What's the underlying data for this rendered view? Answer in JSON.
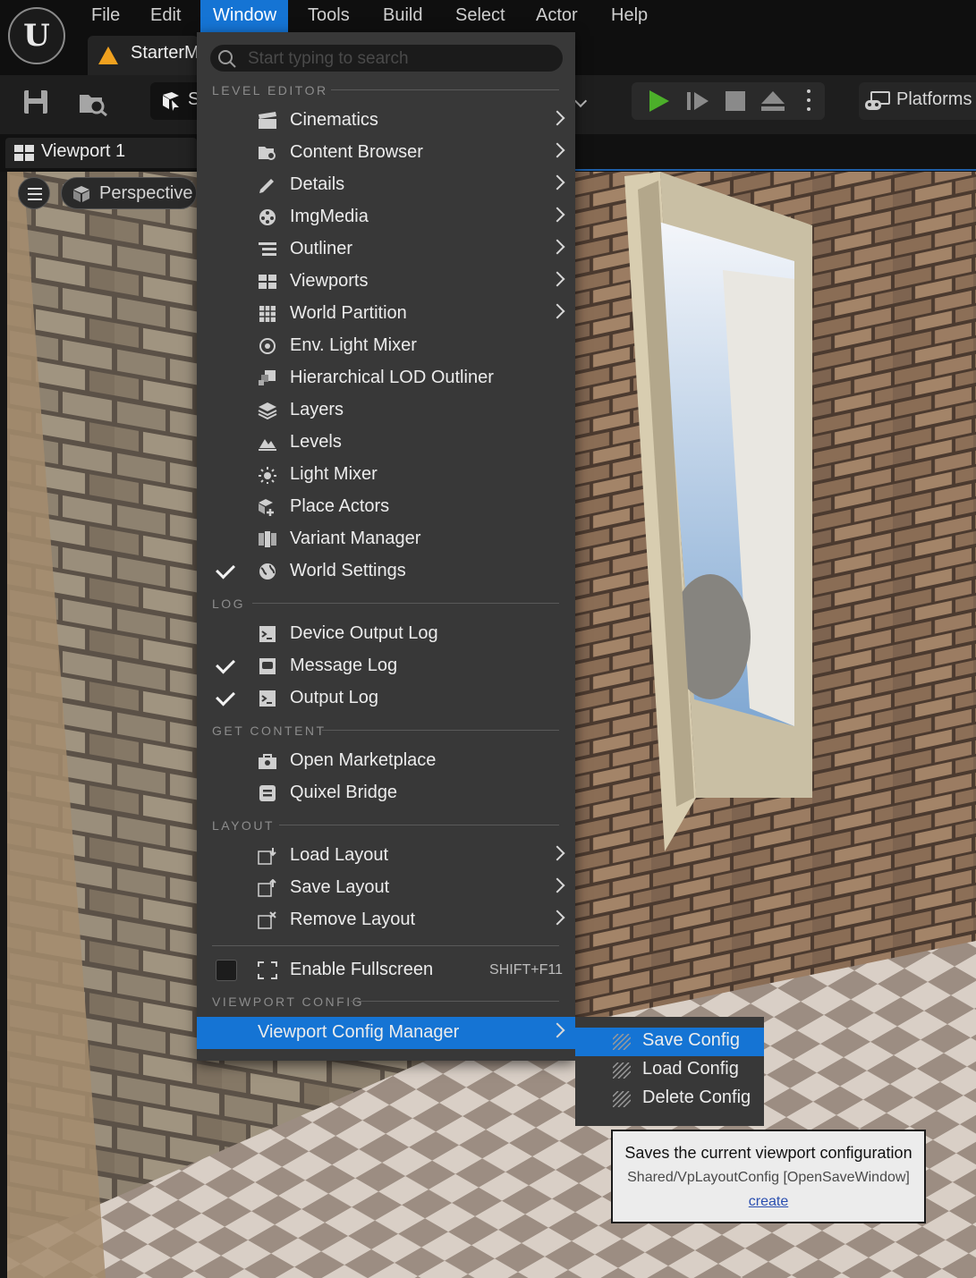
{
  "menubar": {
    "items": [
      "File",
      "Edit",
      "Window",
      "Tools",
      "Build",
      "Select",
      "Actor",
      "Help"
    ],
    "active": "Window"
  },
  "project_tab": {
    "label": "StarterM"
  },
  "toolbar": {
    "mode_label": "S",
    "platforms_label": "Platforms"
  },
  "viewport_tab": {
    "label": "Viewport 1"
  },
  "viewport": {
    "perspective_label": "Perspective"
  },
  "window_menu": {
    "search_placeholder": "Start typing to search",
    "sections": {
      "level_editor": "LEVEL EDITOR",
      "log": "LOG",
      "get_content": "GET CONTENT",
      "layout": "LAYOUT",
      "viewport_config": "VIEWPORT CONFIG"
    },
    "level_editor_items": [
      {
        "label": "Cinematics",
        "icon": "clapperboard-icon",
        "submenu": true
      },
      {
        "label": "Content Browser",
        "icon": "folder-search-icon",
        "submenu": true
      },
      {
        "label": "Details",
        "icon": "pencil-icon",
        "submenu": true
      },
      {
        "label": "ImgMedia",
        "icon": "film-reel-icon",
        "submenu": true
      },
      {
        "label": "Outliner",
        "icon": "list-icon",
        "submenu": true
      },
      {
        "label": "Viewports",
        "icon": "viewports-icon",
        "submenu": true
      },
      {
        "label": "World Partition",
        "icon": "grid-icon",
        "submenu": true
      },
      {
        "label": "Env. Light Mixer",
        "icon": "light-mixer-icon",
        "submenu": false
      },
      {
        "label": "Hierarchical LOD Outliner",
        "icon": "lod-icon",
        "submenu": false
      },
      {
        "label": "Layers",
        "icon": "layers-icon",
        "submenu": false
      },
      {
        "label": "Levels",
        "icon": "levels-icon",
        "submenu": false
      },
      {
        "label": "Light Mixer",
        "icon": "sun-icon",
        "submenu": false
      },
      {
        "label": "Place Actors",
        "icon": "place-actors-icon",
        "submenu": false
      },
      {
        "label": "Variant Manager",
        "icon": "variant-icon",
        "submenu": false
      },
      {
        "label": "World Settings",
        "icon": "globe-icon",
        "submenu": false,
        "checked": true
      }
    ],
    "log_items": [
      {
        "label": "Device Output Log",
        "icon": "terminal-icon",
        "checked": false
      },
      {
        "label": "Message Log",
        "icon": "message-log-icon",
        "checked": true
      },
      {
        "label": "Output Log",
        "icon": "terminal-icon",
        "checked": true
      }
    ],
    "get_content_items": [
      {
        "label": "Open Marketplace",
        "icon": "marketplace-icon"
      },
      {
        "label": "Quixel Bridge",
        "icon": "bridge-icon"
      }
    ],
    "layout_items": [
      {
        "label": "Load Layout",
        "icon": "load-layout-icon",
        "submenu": true
      },
      {
        "label": "Save Layout",
        "icon": "save-layout-icon",
        "submenu": true
      },
      {
        "label": "Remove Layout",
        "icon": "remove-layout-icon",
        "submenu": true
      }
    ],
    "fullscreen": {
      "label": "Enable Fullscreen",
      "shortcut": "SHIFT+F11"
    },
    "viewport_config_manager": {
      "label": "Viewport Config Manager"
    }
  },
  "config_submenu": {
    "items": [
      "Save Config",
      "Load Config",
      "Delete Config"
    ],
    "selected": "Save Config"
  },
  "tooltip": {
    "title": "Saves the current viewport configuration",
    "command": "Shared/VpLayoutConfig [OpenSaveWindow]",
    "link": "create"
  },
  "colors": {
    "accent": "#1574d4",
    "menu_bg": "#383838",
    "play_green": "#4caf2a",
    "warning": "#f0a11f"
  }
}
